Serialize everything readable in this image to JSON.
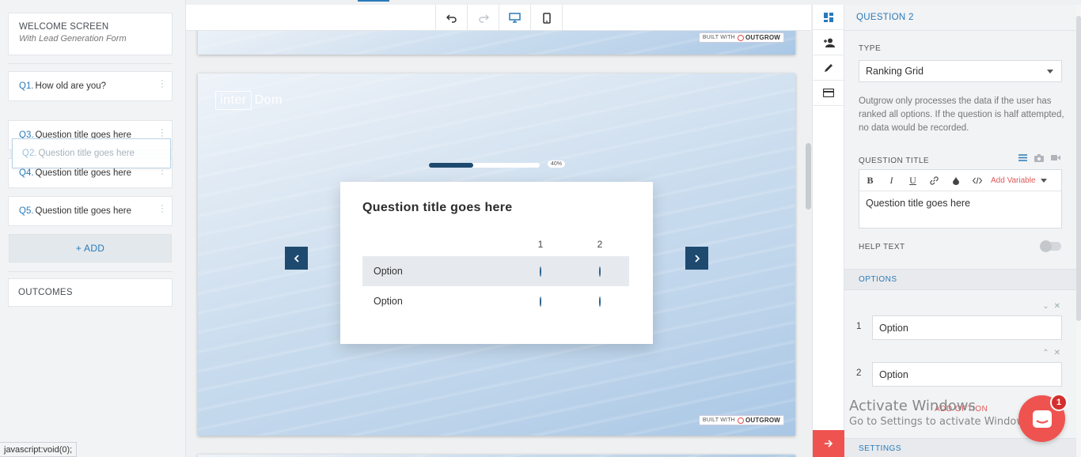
{
  "status_bar": "javascript:void(0);",
  "left": {
    "welcome_title": "WELCOME SCREEN",
    "welcome_subtitle": "With Lead Generation Form",
    "questions": [
      {
        "num": "Q1.",
        "title": "How old are you?"
      },
      {
        "num": "Q3.",
        "title": "Question title goes here"
      },
      {
        "num": "Q4.",
        "title": "Question title goes here"
      },
      {
        "num": "Q5.",
        "title": "Question title goes here"
      }
    ],
    "dragging": {
      "num": "Q2.",
      "title": "Question title goes here"
    },
    "add_label": "+ ADD",
    "outcomes_label": "OUTCOMES"
  },
  "toolbar": {
    "icons": [
      "undo-icon",
      "redo-icon",
      "desktop-icon",
      "mobile-icon"
    ]
  },
  "canvas": {
    "built_with": "BUILT WITH",
    "built_brand": "OUTGROW",
    "logo_box": "inter",
    "logo_text": "Dom",
    "progress_percent": 40,
    "progress_label": "40%",
    "question_title": "Question title goes here",
    "columns": [
      "1",
      "2"
    ],
    "rows": [
      "Option",
      "Option"
    ]
  },
  "panel": {
    "header": "QUESTION 2",
    "type_label": "TYPE",
    "type_value": "Ranking Grid",
    "note": "Outgrow only processes the data if the user has ranked all options. If the question is half attempted, no data would be recorded.",
    "question_title_label": "QUESTION TITLE",
    "add_variable": "Add Variable",
    "editor_text": "Question title goes here",
    "help_text_label": "HELP TEXT",
    "options_label": "OPTIONS",
    "options": [
      {
        "num": "1",
        "value": "Option"
      },
      {
        "num": "2",
        "value": "Option"
      }
    ],
    "add_option": "ADD OPTION",
    "settings_label": "SETTINGS"
  },
  "watermark": {
    "line1": "Activate Windows",
    "line2": "Go to Settings to activate Windows."
  },
  "chat_badge": "1",
  "colors": {
    "accent": "#2a7ab8",
    "navy": "#1e4a6f",
    "red": "#ef5350"
  }
}
